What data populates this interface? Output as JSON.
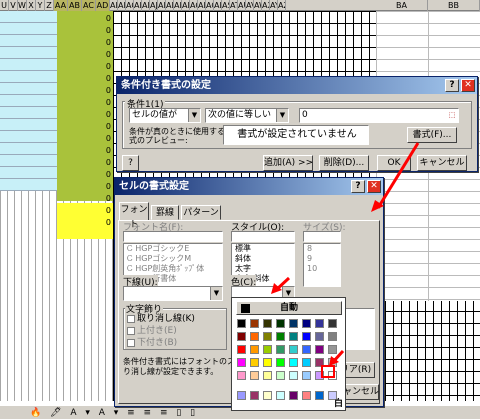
{
  "sheet": {
    "col_headers": [
      "U",
      "V",
      "W",
      "X",
      "Y",
      "Z",
      "AA",
      "AB",
      "AC",
      "AD",
      "AE",
      "AF",
      "AG",
      "AH",
      "AI",
      "AJ",
      "AK",
      "AL",
      "AM",
      "AN",
      "AO",
      "AP",
      "AQ",
      "AR",
      "AS",
      "AT",
      "AU",
      "AV",
      "AW",
      "AX",
      "AY",
      "AZ",
      "BA",
      "BB"
    ],
    "zeros": [
      "0",
      "0",
      "0",
      "0",
      "0",
      "0",
      "0",
      "0",
      "0",
      "0",
      "0",
      "0",
      "0",
      "0",
      "0",
      "0",
      "0",
      "0"
    ],
    "toolbar_text": "🔥 🖊 A ▾ A ▾ ≡ ≡ ≡ ▯ ▯"
  },
  "cond_dialog": {
    "title": "条件付き書式の設定",
    "help": "?",
    "close": "✕",
    "condition_label": "条件1(1)",
    "field1": "セルの値が",
    "field2": "次の値に等しい",
    "value": "0",
    "preview_caption1": "条件が真のときに使用する書",
    "preview_caption2": "式のプレビュー:",
    "preview_text": "書式が設定されていません",
    "format_button": "書式(F)...",
    "add_button": "追加(A) >>",
    "delete_button": "削除(D)...",
    "ok_button": "OK",
    "cancel_button": "キャンセル"
  },
  "format_dialog": {
    "title": "セルの書式設定",
    "tabs": [
      "フォント",
      "罫線",
      "パターン"
    ],
    "font_name_label": "フォント名(F):",
    "style_label": "スタイル(O):",
    "size_label": "サイズ(S):",
    "fonts": [
      "HGPゴシックE",
      "HGPゴシックM",
      "HGP創英角ﾎﾟｯﾌﾟ体",
      "HGP行書体"
    ],
    "styles": [
      "標準",
      "斜体",
      "太字",
      "太字 斜体"
    ],
    "sizes": [
      "8",
      "9",
      "10"
    ],
    "underline_label": "下線(U):",
    "color_label": "色(C):",
    "effects_label": "文字飾り",
    "strike": "取り消し線(K)",
    "superscript": "上付き(E)",
    "subscript": "下付き(B)",
    "note1": "条件付き書式にはフォントのスタイル",
    "note2": "り消し線が設定できます。",
    "clear_button": "クリア(R)",
    "cancel_button": "キャンセル"
  },
  "palette": {
    "auto_label": "自動",
    "white_label": "白",
    "colors": [
      [
        "#000000",
        "#993300",
        "#333300",
        "#003300",
        "#003366",
        "#000080",
        "#333399",
        "#333333"
      ],
      [
        "#800000",
        "#ff6600",
        "#808000",
        "#008000",
        "#008080",
        "#0000ff",
        "#666699",
        "#808080"
      ],
      [
        "#ff0000",
        "#ff9900",
        "#99cc00",
        "#339966",
        "#33cccc",
        "#3366ff",
        "#800080",
        "#969696"
      ],
      [
        "#ff00ff",
        "#ffcc00",
        "#ffff00",
        "#00ff00",
        "#00ffff",
        "#00ccff",
        "#993366",
        "#c0c0c0"
      ],
      [
        "#ff99cc",
        "#ffcc99",
        "#ffff99",
        "#ccffcc",
        "#ccffff",
        "#99ccff",
        "#cc99ff",
        "#ffffff"
      ],
      [
        "#9999ff",
        "#993366",
        "#ffffcc",
        "#ccffff",
        "#660066",
        "#ff8080",
        "#0066cc",
        "#ccccff"
      ]
    ],
    "accent": "#ff0000"
  }
}
